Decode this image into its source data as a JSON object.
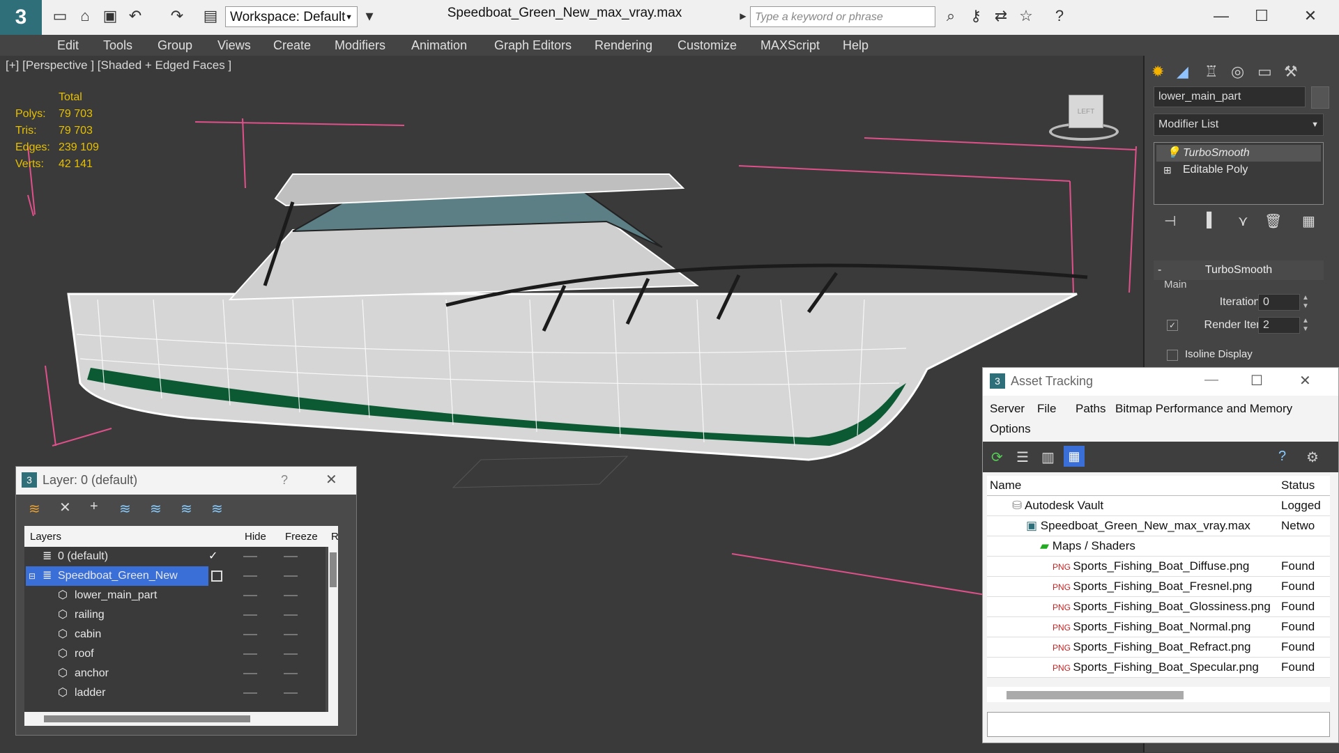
{
  "titlebar": {
    "workspace": "Workspace: Default",
    "document_title": "Speedboat_Green_New_max_vray.max",
    "search_placeholder": "Type a keyword or phrase"
  },
  "menu": [
    "Edit",
    "Tools",
    "Group",
    "Views",
    "Create",
    "Modifiers",
    "Animation",
    "Graph Editors",
    "Rendering",
    "Customize",
    "MAXScript",
    "Help"
  ],
  "viewport": {
    "label": "[+] [Perspective ] [Shaded + Edged Faces ]",
    "stats": {
      "header": "Total",
      "rows": [
        {
          "label": "Polys:",
          "value": "79 703"
        },
        {
          "label": "Tris:",
          "value": "79 703"
        },
        {
          "label": "Edges:",
          "value": "239 109"
        },
        {
          "label": "Verts:",
          "value": "42 141"
        }
      ]
    },
    "viewcube_label": "LEFT"
  },
  "command_panel": {
    "object_name": "lower_main_part",
    "modifier_list": "Modifier List",
    "stack": [
      "TurboSmooth",
      "Editable Poly"
    ],
    "turbosmooth": {
      "title": "TurboSmooth",
      "section": "Main",
      "iterations_label": "Iterations:",
      "iterations_value": "0",
      "render_iters_label": "Render Iters:",
      "render_iters_value": "2",
      "isoline_label": "Isoline Display"
    }
  },
  "asset_tracking": {
    "title": "Asset Tracking",
    "menu": [
      "Server",
      "File",
      "Paths",
      "Bitmap Performance and Memory",
      "Options"
    ],
    "columns": [
      "Name",
      "Status"
    ],
    "rows": [
      {
        "name": "Autodesk Vault",
        "status": "Logged"
      },
      {
        "name": "Speedboat_Green_New_max_vray.max",
        "status": "Netwo"
      },
      {
        "name": "Maps / Shaders",
        "status": ""
      },
      {
        "name": "Sports_Fishing_Boat_Diffuse.png",
        "status": "Found"
      },
      {
        "name": "Sports_Fishing_Boat_Fresnel.png",
        "status": "Found"
      },
      {
        "name": "Sports_Fishing_Boat_Glossiness.png",
        "status": "Found"
      },
      {
        "name": "Sports_Fishing_Boat_Normal.png",
        "status": "Found"
      },
      {
        "name": "Sports_Fishing_Boat_Refract.png",
        "status": "Found"
      },
      {
        "name": "Sports_Fishing_Boat_Specular.png",
        "status": "Found"
      }
    ]
  },
  "layer_window": {
    "title": "Layer: 0 (default)",
    "help": "?",
    "columns": [
      "Layers",
      "Hide",
      "Freeze",
      "R"
    ],
    "rows": [
      {
        "name": "0 (default)"
      },
      {
        "name": "Speedboat_Green_New"
      },
      {
        "name": "lower_main_part"
      },
      {
        "name": "railing"
      },
      {
        "name": "cabin"
      },
      {
        "name": "roof"
      },
      {
        "name": "anchor"
      },
      {
        "name": "ladder"
      }
    ]
  },
  "colors": {
    "accent": "#2e6f7a",
    "selection": "#3a6fd8",
    "stats": "#e7c000",
    "hull_green": "#0c5a33"
  }
}
